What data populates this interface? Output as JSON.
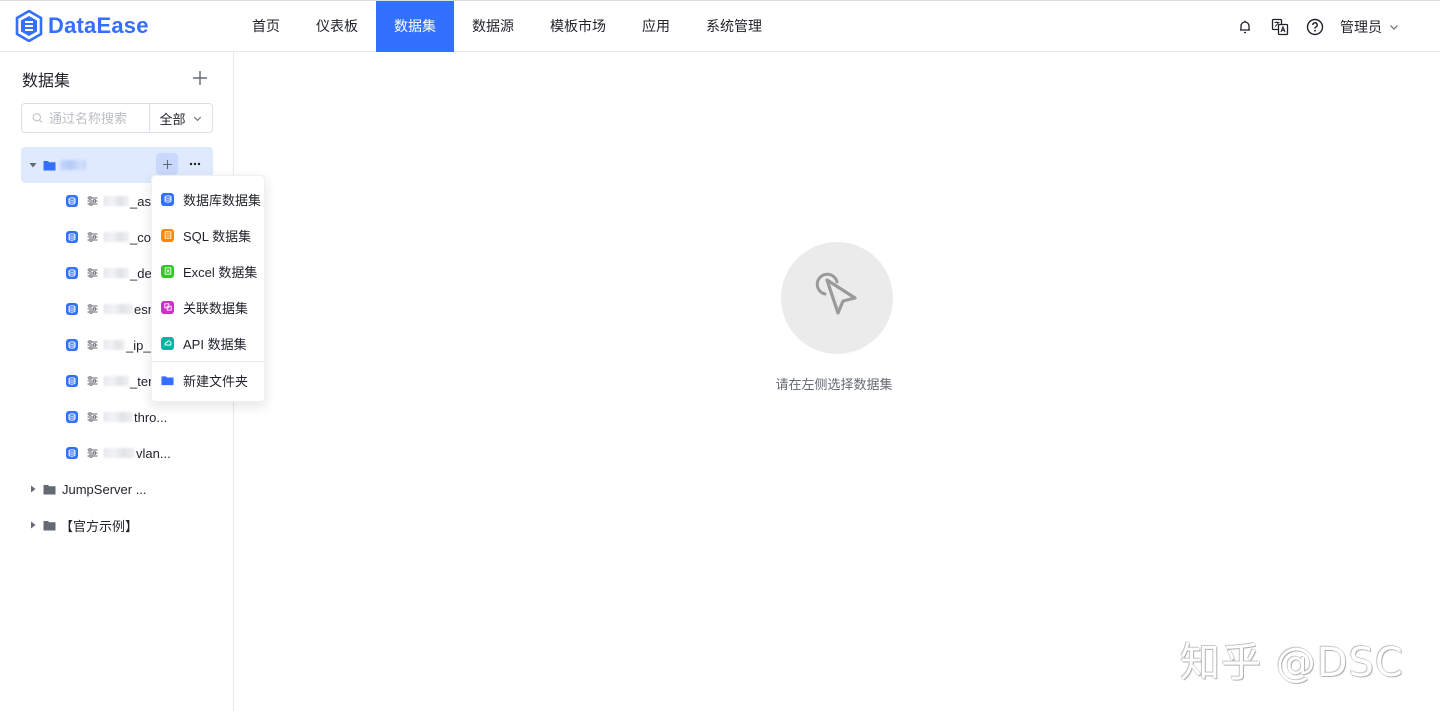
{
  "app": {
    "logo_text": "DataEase"
  },
  "nav": {
    "items": [
      {
        "label": "首页"
      },
      {
        "label": "仪表板"
      },
      {
        "label": "数据集"
      },
      {
        "label": "数据源"
      },
      {
        "label": "模板市场"
      },
      {
        "label": "应用"
      },
      {
        "label": "系统管理"
      }
    ],
    "active_index": 2
  },
  "header": {
    "user_label": "管理员"
  },
  "sidebar": {
    "title": "数据集",
    "search_placeholder": "通过名称搜索",
    "scope_label": "全部",
    "tree": {
      "root_folder": {
        "expanded": true,
        "selected": true
      },
      "leaves": [
        {
          "suffix": "_ass"
        },
        {
          "suffix": "_cor"
        },
        {
          "suffix": "_dev"
        },
        {
          "suffix": "esm"
        },
        {
          "suffix": "_ip_"
        },
        {
          "suffix": "_ten"
        },
        {
          "suffix": "thro..."
        },
        {
          "suffix": "vlan..."
        }
      ],
      "folders": [
        {
          "label": "JumpServer ..."
        },
        {
          "label": "【官方示例】"
        }
      ]
    }
  },
  "create_menu": {
    "items": [
      {
        "label": "数据库数据集",
        "icon": "database-icon",
        "color": "#3370ff"
      },
      {
        "label": "SQL 数据集",
        "icon": "sql-icon",
        "color": "#ff8800"
      },
      {
        "label": "Excel 数据集",
        "icon": "excel-icon",
        "color": "#34c724"
      },
      {
        "label": "关联数据集",
        "icon": "union-icon",
        "color": "#c932c9"
      },
      {
        "label": "API 数据集",
        "icon": "api-icon",
        "color": "#00b5a5"
      }
    ],
    "folder_item": {
      "label": "新建文件夹",
      "icon": "folder-icon",
      "color": "#3370ff"
    }
  },
  "main": {
    "empty_text": "请在左侧选择数据集"
  },
  "watermark": {
    "text": "知乎 @DSC"
  },
  "colors": {
    "accent": "#3370ff",
    "selected_bg": "#e0eaff"
  }
}
